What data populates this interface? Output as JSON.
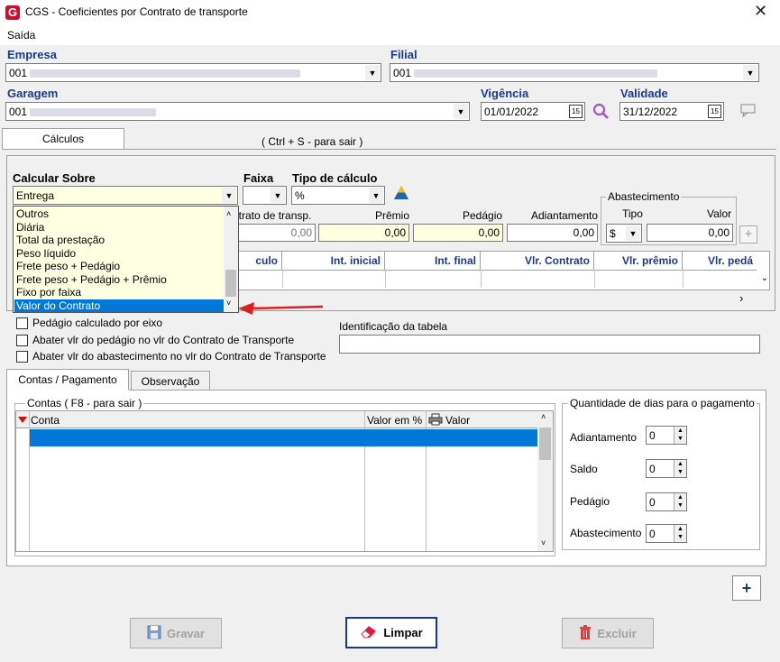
{
  "window": {
    "title": "CGS - Coeficientes por Contrato de transporte",
    "logo": "G",
    "close": "✕"
  },
  "menu": {
    "exit": "Saída"
  },
  "empresa": {
    "label": "Empresa",
    "value": "001"
  },
  "filial": {
    "label": "Filial",
    "value": "001"
  },
  "garagem": {
    "label": "Garagem",
    "value": "001"
  },
  "vigencia": {
    "label": "Vigência",
    "value": "01/01/2022"
  },
  "validade": {
    "label": "Validade",
    "value": "31/12/2022"
  },
  "tabs": {
    "calculos": "Cálculos",
    "hint": "( Ctrl + S - para sair )"
  },
  "calc": {
    "calcular_sobre_label": "Calcular Sobre",
    "calcular_sobre_value": "Entrega",
    "faixa_label": "Faixa",
    "tipo_calculo_label": "Tipo de cálculo",
    "tipo_calculo_value": "%",
    "options": [
      "Outros",
      "Diária",
      "Total da prestação",
      "Peso líquido",
      "Frete peso + Pedágio",
      "Frete peso + Pedágio + Prêmio",
      "Fixo por faixa",
      "Valor do Contrato"
    ],
    "selected_option": "Valor do Contrato"
  },
  "values": {
    "contrato_label": "ntrato de transp.",
    "contrato_value": "0,00",
    "premio_label": "Prêmio",
    "premio_value": "0,00",
    "pedagio_label": "Pedágio",
    "pedagio_value": "0,00",
    "adiantamento_label": "Adiantamento",
    "adiantamento_value": "0,00"
  },
  "abastecimento": {
    "group": "Abastecimento",
    "tipo_label": "Tipo",
    "tipo_value": "$",
    "valor_label": "Valor",
    "valor_value": "0,00"
  },
  "grid": {
    "headers": [
      "culo",
      "Int. inicial",
      "Int. final",
      "Vlr. Contrato",
      "Vlr. prêmio",
      "Vlr. pedá"
    ]
  },
  "options": {
    "pedagio_eixo": "Pedágio calculado por eixo",
    "abater_pedagio": "Abater vlr do pedágio no vlr do Contrato de Transporte",
    "abater_abastecimento": "Abater vlr do abastecimento no vlr do Contrato de Transporte",
    "identificacao_label": "Identificação da tabela"
  },
  "lower_tabs": {
    "contas": "Contas / Pagamento",
    "observacao": "Observação"
  },
  "contas": {
    "group": "Contas ( F8 - para sair )",
    "col_conta": "Conta",
    "col_valor_pct": "Valor em %",
    "col_valor": "Valor"
  },
  "dias": {
    "group": "Quantidade de dias para o pagamento",
    "adiantamento_label": "Adiantamento",
    "adiantamento_value": "0",
    "saldo_label": "Saldo",
    "saldo_value": "0",
    "pedagio_label": "Pedágio",
    "pedagio_value": "0",
    "abastecimento_label": "Abastecimento",
    "abastecimento_value": "0"
  },
  "buttons": {
    "gravar": "Gravar",
    "limpar": "Limpar",
    "excluir": "Excluir",
    "add": "+"
  },
  "colors": {
    "label_blue": "#1a3b8c",
    "selection": "#0078d7",
    "arrow": "#e02020"
  }
}
